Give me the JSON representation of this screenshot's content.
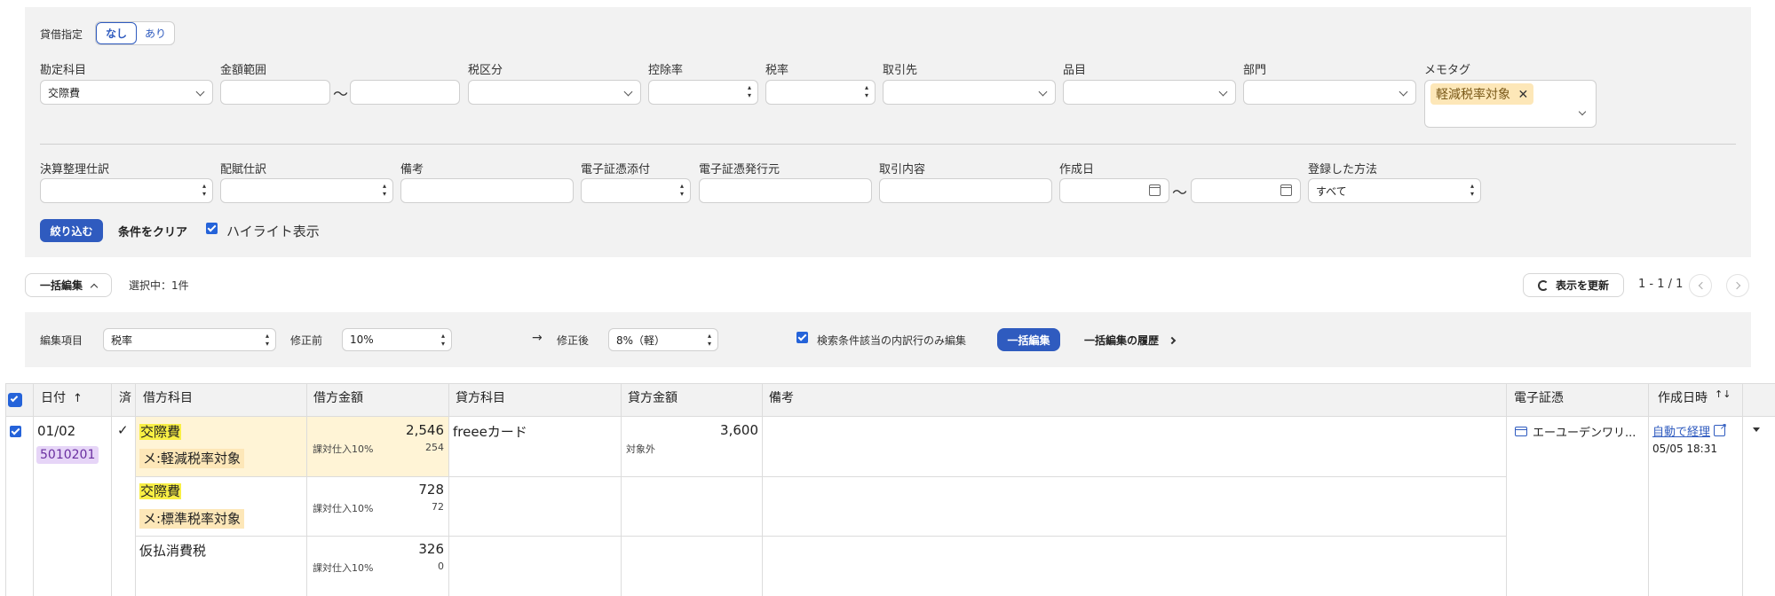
{
  "filter": {
    "taishaku": {
      "label": "貸借指定",
      "opt_none": "なし",
      "opt_yes": "あり"
    },
    "labels": {
      "account": "勘定科目",
      "amount_range": "金額範囲",
      "tax_category": "税区分",
      "deduction_rate": "控除率",
      "tax_rate": "税率",
      "partner": "取引先",
      "item": "品目",
      "department": "部門",
      "memo_tag": "メモタグ",
      "closing": "決算整理仕訳",
      "allocation": "配賦仕訳",
      "remarks": "備考",
      "ev_attach": "電子証憑添付",
      "ev_issuer": "電子証憑発行元",
      "txn_content": "取引内容",
      "created_date": "作成日",
      "reg_method": "登録した方法"
    },
    "values": {
      "account": "交際費",
      "memo_tag_chip": "軽減税率対象",
      "reg_method": "すべて"
    },
    "tilde": "〜",
    "apply_label": "絞り込む",
    "clear_label": "条件をクリア",
    "highlight_label": "ハイライト表示"
  },
  "toolbar": {
    "bulk_edit_label": "一括編集",
    "selected_text": "選択中：1件",
    "refresh_label": "表示を更新",
    "pagination": "1 - 1 / 1"
  },
  "bulk": {
    "field_label": "編集項目",
    "field_value": "税率",
    "before_label": "修正前",
    "before_value": "10%",
    "arrow": "→",
    "after_label": "修正後",
    "after_value": "8%（軽）",
    "only_matching_label": "検索条件該当の内訳行のみ編集",
    "apply_label": "一括編集",
    "history_label": "一括編集の履歴"
  },
  "table": {
    "headers": {
      "date": "日付",
      "done": "済",
      "debit_account": "借方科目",
      "debit_amount": "借方金額",
      "credit_account": "貸方科目",
      "credit_amount": "貸方金額",
      "remarks": "備考",
      "evidence": "電子証憑",
      "created_at": "作成日時"
    },
    "row": {
      "date": "01/02",
      "number": "5010201",
      "done_mark": "✓",
      "credit_account": "freeeカード",
      "credit_amount": "3,600",
      "credit_tax": "対象外",
      "evidence": "エーユーデンワリ...",
      "auto_link": "自動で経理",
      "created_at": "05/05 18:31",
      "lines": [
        {
          "account": "交際費",
          "memo": "メ:軽減税率対象",
          "amount": "2,546",
          "tax_cat": "課対仕入10%",
          "tax": "254"
        },
        {
          "account": "交際費",
          "memo": "メ:標準税率対象",
          "amount": "728",
          "tax_cat": "課対仕入10%",
          "tax": "72"
        },
        {
          "account": "仮払消費税",
          "memo": "",
          "amount": "326",
          "tax_cat": "課対仕入10%",
          "tax": "0"
        }
      ]
    }
  },
  "colors": {
    "accent": "#2f5bbf",
    "highlight": "#f8ef45",
    "memo_bg": "#fde7b8",
    "row_bg": "#fff4d6",
    "number_badge": "#e6d5f7"
  }
}
